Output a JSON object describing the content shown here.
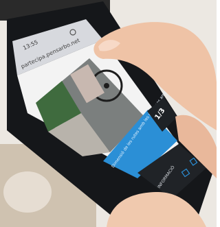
{
  "phone": {
    "status_time": "13:55",
    "url": "partecipa.pensarbo.net",
    "counter": "1/3",
    "informacio": "INFORMACIÓ",
    "banner_text": "Dimensió de les rutes amb les persones amb diversitat funcional"
  },
  "colors": {
    "accent_blue": "#2b8fd6",
    "phone_black": "#15171a",
    "browser_gray": "#d7d9de",
    "background": "#e8e4e0"
  }
}
